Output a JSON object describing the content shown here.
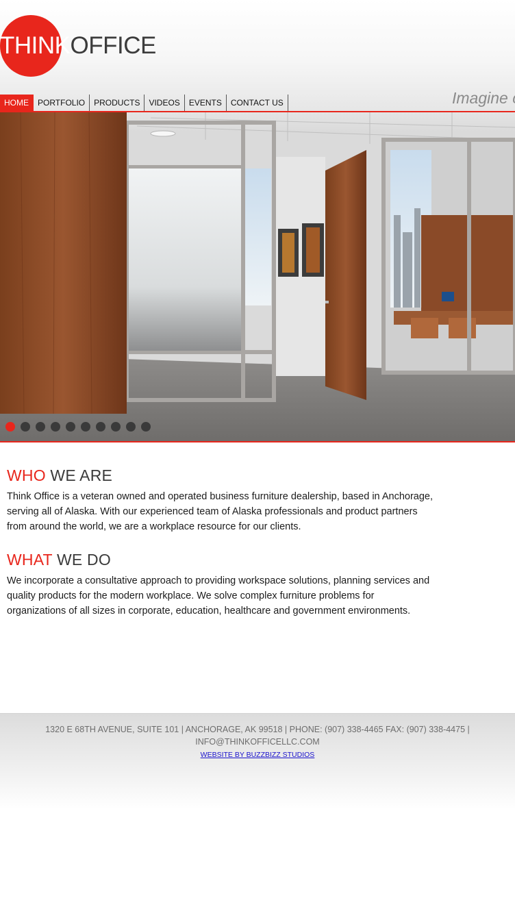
{
  "brand": {
    "logo_part1": "THINK",
    "logo_part2": "OFFICE",
    "accent_color": "#e8261c",
    "dark_color": "#3c3c3c"
  },
  "nav": {
    "items": [
      {
        "label": "HOME",
        "active": true
      },
      {
        "label": "PORTFOLIO",
        "active": false
      },
      {
        "label": "PRODUCTS",
        "active": false
      },
      {
        "label": "VIDEOS",
        "active": false
      },
      {
        "label": "EVENTS",
        "active": false
      },
      {
        "label": "CONTACT US",
        "active": false
      }
    ],
    "tagline": "Imagine c"
  },
  "slider": {
    "image": "office-interior-photo",
    "slide_count": 10,
    "active_slide": 1
  },
  "who": {
    "heading_red": "WHO",
    "heading_dark": "WE ARE",
    "text": "Think Office is a veteran owned and operated business furniture dealership, based in Anchorage, serving all of Alaska. With our experienced team of Alaska professionals and product partners from around the world, we are a workplace resource for our clients."
  },
  "what": {
    "heading_red": "WHAT",
    "heading_dark": "WE DO",
    "text": "We incorporate a consultative approach to providing workspace solutions, planning services and quality products for the modern workplace. We solve complex furniture problems for organizations of all sizes in corporate, education, healthcare and government environments."
  },
  "footer": {
    "address": "1320 E 68TH AVENUE, SUITE 101 | ANCHORAGE, AK 99518 | PHONE: (907) 338-4465 FAX: (907) 338-4475 | INFO@THINKOFFICELLC.COM",
    "credit": "WEBSITE BY BUZZBIZZ STUDIOS"
  }
}
